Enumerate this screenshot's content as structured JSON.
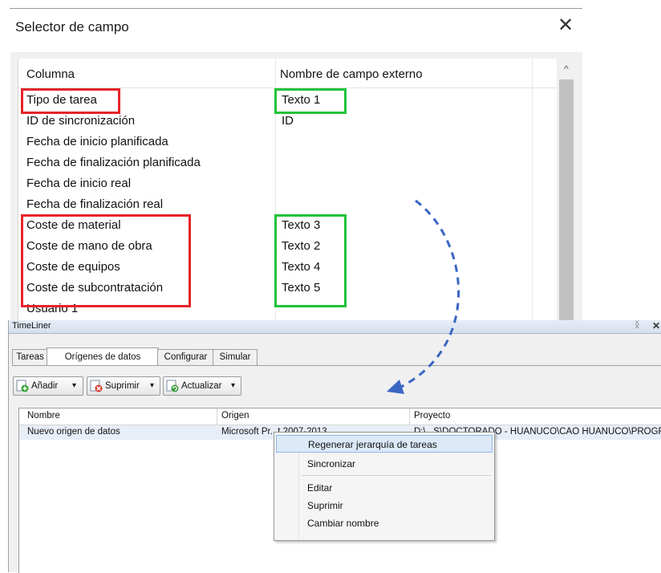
{
  "selector_dialog": {
    "title": "Selector de campo",
    "close_glyph": "✕",
    "columns": [
      "Columna",
      "Nombre de campo externo"
    ],
    "rows": [
      {
        "column": "Tipo de tarea",
        "external": "Texto 1"
      },
      {
        "column": "ID de sincronización",
        "external": "ID"
      },
      {
        "column": "Fecha de inicio planificada",
        "external": ""
      },
      {
        "column": "Fecha de finalización planificada",
        "external": ""
      },
      {
        "column": "Fecha de inicio real",
        "external": ""
      },
      {
        "column": "Fecha de finalización real",
        "external": ""
      },
      {
        "column": "Coste de material",
        "external": "Texto 3"
      },
      {
        "column": "Coste de mano de obra",
        "external": "Texto 2"
      },
      {
        "column": "Coste de equipos",
        "external": "Texto 4"
      },
      {
        "column": "Coste de subcontratación",
        "external": "Texto 5"
      },
      {
        "column": "Usuario 1",
        "external": ""
      }
    ],
    "scroll_up_glyph": "^"
  },
  "timeliner": {
    "title": "TimeLiner",
    "pin_glyph": "ᛝ",
    "close_glyph": "✕",
    "tabs": [
      "Tareas",
      "Orígenes de datos",
      "Configurar",
      "Simular"
    ],
    "active_tab": "Orígenes de datos",
    "toolbar": {
      "add": "Añadir",
      "delete": "Suprimir",
      "refresh": "Actualizar",
      "dropdown_glyph": "▾"
    },
    "list_columns": [
      "Nombre",
      "Origen",
      "Proyecto"
    ],
    "rows": [
      {
        "name": "Nuevo origen de datos",
        "origin": "Microsoft Pr...t 2007-2013",
        "project": "D:\\...S\\DOCTORADO - HUANUCO\\CAO HUANUCO\\PROGRA"
      }
    ]
  },
  "context_menu": {
    "items": [
      "Regenerar jerarquía de tareas",
      "Sincronizar",
      "Editar",
      "Suprimir",
      "Cambiar nombre"
    ],
    "highlighted_item": "Regenerar jerarquía de tareas"
  },
  "colors": {
    "highlight_red": "#e5242b",
    "highlight_green": "#21c23a",
    "arrow_blue": "#3a66c4"
  }
}
